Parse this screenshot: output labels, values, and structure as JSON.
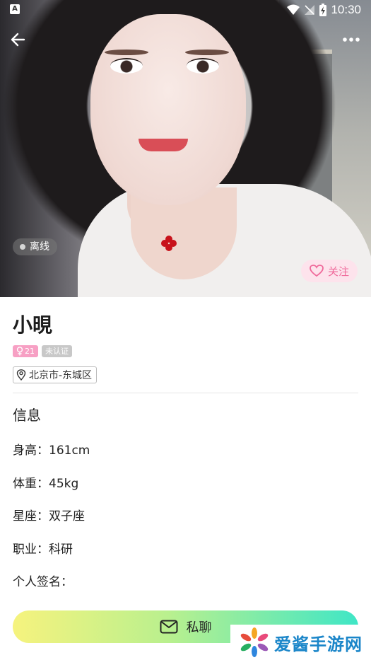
{
  "status_bar": {
    "time": "10:30",
    "app_icon": "A"
  },
  "header": {
    "back_icon": "arrow-left-icon",
    "more_icon": "more-dots-icon"
  },
  "photo": {
    "online_status": "离线",
    "follow_label": "关注"
  },
  "profile": {
    "name": "小晛",
    "age": "21",
    "gender_icon": "female-icon",
    "verify_badge": "未认证",
    "location": "北京市-东城区"
  },
  "info": {
    "title": "信息",
    "rows": [
      "身高：161cm",
      "体重：45kg",
      "星座：双子座",
      "职业：科研",
      "个人签名："
    ],
    "cut_text": "…"
  },
  "actions": {
    "chat_label": "私聊"
  },
  "watermark": {
    "text": "爱酱手游网"
  },
  "colors": {
    "pink": "#f06a9b",
    "follow_bg": "#fde3ec",
    "chat_start": "#f6f37e",
    "chat_end": "#3fe6c6"
  }
}
